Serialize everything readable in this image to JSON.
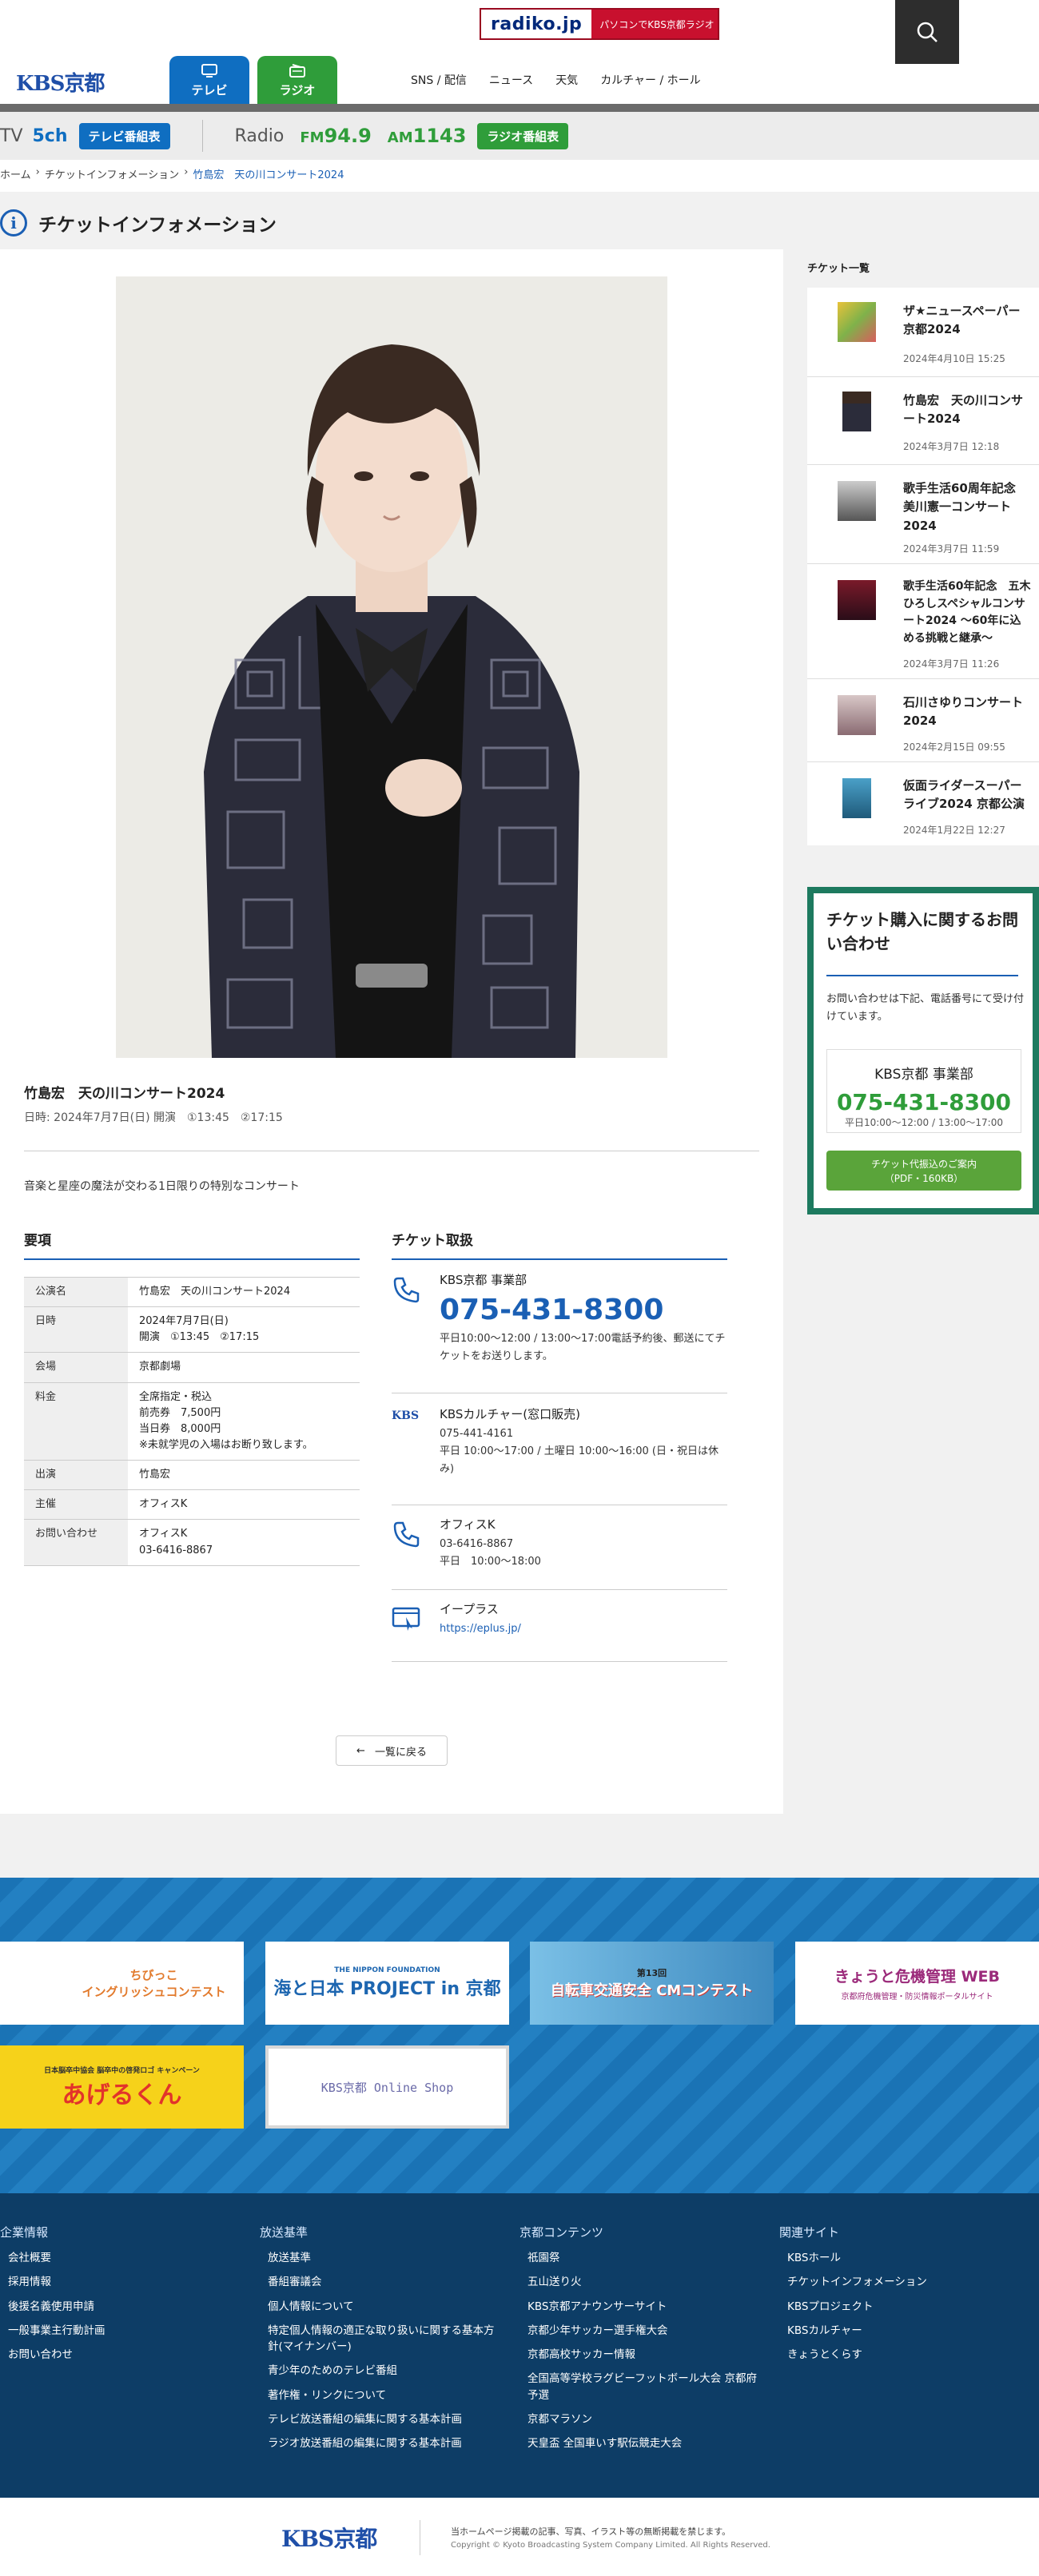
{
  "header": {
    "radiko_logo": "radiko.jp",
    "radiko_text": "パソコンでKBS京都ラジオ",
    "logo": "KBS京都",
    "tabs": [
      "テレビ",
      "ラジオ"
    ],
    "nav": [
      "SNS / 配信",
      "ニュース",
      "天気",
      "カルチャー / ホール"
    ]
  },
  "channel": {
    "tv": "TV",
    "tv_ch": "5ch",
    "tv_btn": "テレビ番組表",
    "radio": "Radio",
    "fm_label": "FM",
    "fm_freq": "94.9",
    "am_label": "AM",
    "am_freq": "1143",
    "radio_btn": "ラジオ番組表"
  },
  "breadcrumb": [
    "ホーム",
    "チケットインフォメーション",
    "竹島宏　天の川コンサート2024"
  ],
  "page_title": "チケットインフォメーション",
  "event": {
    "title": "竹島宏　天の川コンサート2024",
    "date_line": "日時: 2024年7月7日(日) 開演　①13:45　②17:15",
    "description": "音楽と星座の魔法が交わる1日限りの特別なコンサート"
  },
  "spec": {
    "heading": "要項",
    "rows": [
      {
        "k": "公演名",
        "v": "竹島宏　天の川コンサート2024"
      },
      {
        "k": "日時",
        "v": "2024年7月7日(日)\n開演　①13:45　②17:15"
      },
      {
        "k": "会場",
        "v": "京都劇場"
      },
      {
        "k": "料金",
        "v": "全席指定・税込\n前売券　7,500円\n当日券　8,000円\n※未就学児の入場はお断り致します。"
      },
      {
        "k": "出演",
        "v": "竹島宏"
      },
      {
        "k": "主催",
        "v": "オフィスK"
      },
      {
        "k": "お問い合わせ",
        "v": "オフィスK\n03-6416-8867"
      }
    ]
  },
  "tickets": {
    "heading": "チケット取扱",
    "items": [
      {
        "name": "KBS京都 事業部",
        "big": "075-431-8300",
        "note": "平日10:00～12:00 / 13:00～17:00電話予約後、郵送にてチケットをお送りします。"
      },
      {
        "name": "KBSカルチャー(窓口販売)",
        "tel": "075-441-4161",
        "note": "平日 10:00～17:00 / 土曜日 10:00～16:00 (日・祝日は休み)"
      },
      {
        "name": "オフィスK",
        "tel": "03-6416-8867",
        "note": "平日　10:00～18:00"
      },
      {
        "name": "イープラス",
        "link": "https://eplus.jp/"
      }
    ],
    "kbs_logo": "KBS"
  },
  "back_button": "一覧に戻る",
  "sidebar": {
    "heading": "チケット一覧",
    "items": [
      {
        "title": "ザ★ニュースペーパー 京都2024",
        "date": "2024年4月10日 15:25"
      },
      {
        "title": "竹島宏　天の川コンサート2024",
        "date": "2024年3月7日 12:18"
      },
      {
        "title": "歌手生活60周年記念 美川憲一コンサート2024",
        "date": "2024年3月7日 11:59"
      },
      {
        "title": "歌手生活60年記念　五木ひろしスペシャルコンサート2024 ～60年に込める挑戦と継承～",
        "date": "2024年3月7日 11:26"
      },
      {
        "title": "石川さゆりコンサート2024",
        "date": "2024年2月15日 09:55"
      },
      {
        "title": "仮面ライダースーパーライブ2024 京都公演",
        "date": "2024年1月22日 12:27"
      }
    ],
    "contact": {
      "title": "チケット購入に関するお問い合わせ",
      "text": "お問い合わせは下記、電話番号にて受け付けています。",
      "dept": "KBS京都 事業部",
      "tel": "075-431-8300",
      "hours": "平日10:00～12:00 / 13:00～17:00",
      "btn": "チケット代振込のご案内\n（PDF・160KB）"
    }
  },
  "banners": [
    {
      "text": "ちびっこ\nイングリッシュコンテスト"
    },
    {
      "text": "海と日本 PROJECT in 京都",
      "sub": "THE NIPPON FOUNDATION"
    },
    {
      "text": "自転車交通安全 CMコンテスト",
      "sub": "第13回"
    },
    {
      "text": "きょうと危機管理 WEB",
      "sub": "京都府危機管理・防災情報ポータルサイト"
    },
    {
      "text": "あげるくん",
      "sub": "日本脳卒中協会 脳卒中の啓発ロゴ キャンペーン"
    },
    {
      "text": "KBS京都 Online Shop"
    }
  ],
  "footer": {
    "cols": [
      {
        "h": "企業情報",
        "items": [
          "会社概要",
          "採用情報",
          "後援名義使用申請",
          "一般事業主行動計画",
          "お問い合わせ"
        ]
      },
      {
        "h": "放送基準",
        "items": [
          "放送基準",
          "番組審議会",
          "個人情報について",
          "特定個人情報の適正な取り扱いに関する基本方針(マイナンバー)",
          "青少年のためのテレビ番組",
          "著作権・リンクについて",
          "テレビ放送番組の編集に関する基本計画",
          "ラジオ放送番組の編集に関する基本計画"
        ]
      },
      {
        "h": "京都コンテンツ",
        "items": [
          "祇園祭",
          "五山送り火",
          "KBS京都アナウンサーサイト",
          "京都少年サッカー選手権大会",
          "京都高校サッカー情報",
          "全国高等学校ラグビーフットボール大会 京都府予選",
          "京都マラソン",
          "天皇盃 全国車いす駅伝競走大会"
        ]
      },
      {
        "h": "関連サイト",
        "items": [
          "KBSホール",
          "チケットインフォメーション",
          "KBSプロジェクト",
          "KBSカルチャー",
          "きょうとくらす"
        ]
      }
    ],
    "copy_logo": "KBS京都",
    "notice": "当ホームページ掲載の記事、写真、イラスト等の無断掲載を禁じます。",
    "copyright": "Copyright © Kyoto Broadcasting System Company Limited. All Rights Reserved."
  }
}
